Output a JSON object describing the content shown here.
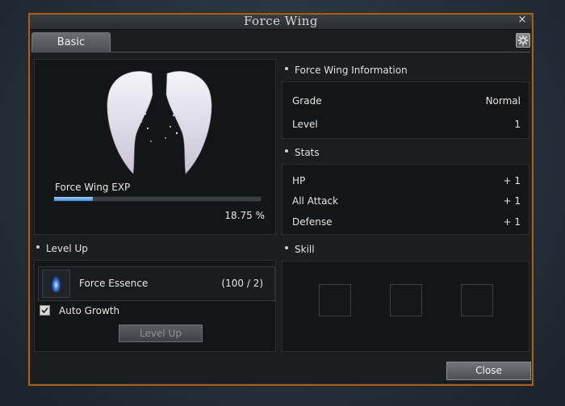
{
  "window": {
    "title": "Force Wing",
    "close_glyph": "×"
  },
  "tabs": [
    {
      "label": "Basic",
      "active": true
    }
  ],
  "icons": {
    "settings": "settings-gear-icon",
    "essence": "blue-flame-icon",
    "wings": "force-wing-image"
  },
  "preview": {
    "exp_label": "Force Wing EXP",
    "exp_fraction": 0.1875,
    "exp_percent_text": "18.75 %"
  },
  "info": {
    "header": "Force Wing Information",
    "rows": [
      {
        "label": "Grade",
        "value": "Normal"
      },
      {
        "label": "Level",
        "value": "1"
      }
    ]
  },
  "stats": {
    "header": "Stats",
    "rows": [
      {
        "label": "HP",
        "value": "+ 1"
      },
      {
        "label": "All Attack",
        "value": "+ 1"
      },
      {
        "label": "Defense",
        "value": "+ 1"
      }
    ]
  },
  "levelup": {
    "header": "Level Up",
    "item_name": "Force Essence",
    "item_count": "(100 / 2)",
    "auto_growth_label": "Auto Growth",
    "auto_growth_checked": true,
    "button_label": "Level Up",
    "button_enabled": false
  },
  "skill": {
    "header": "Skill",
    "slot_count": 3
  },
  "footer": {
    "close_label": "Close"
  },
  "colors": {
    "frame": "#a0621f",
    "exp_fill": "#3e8ed4"
  }
}
